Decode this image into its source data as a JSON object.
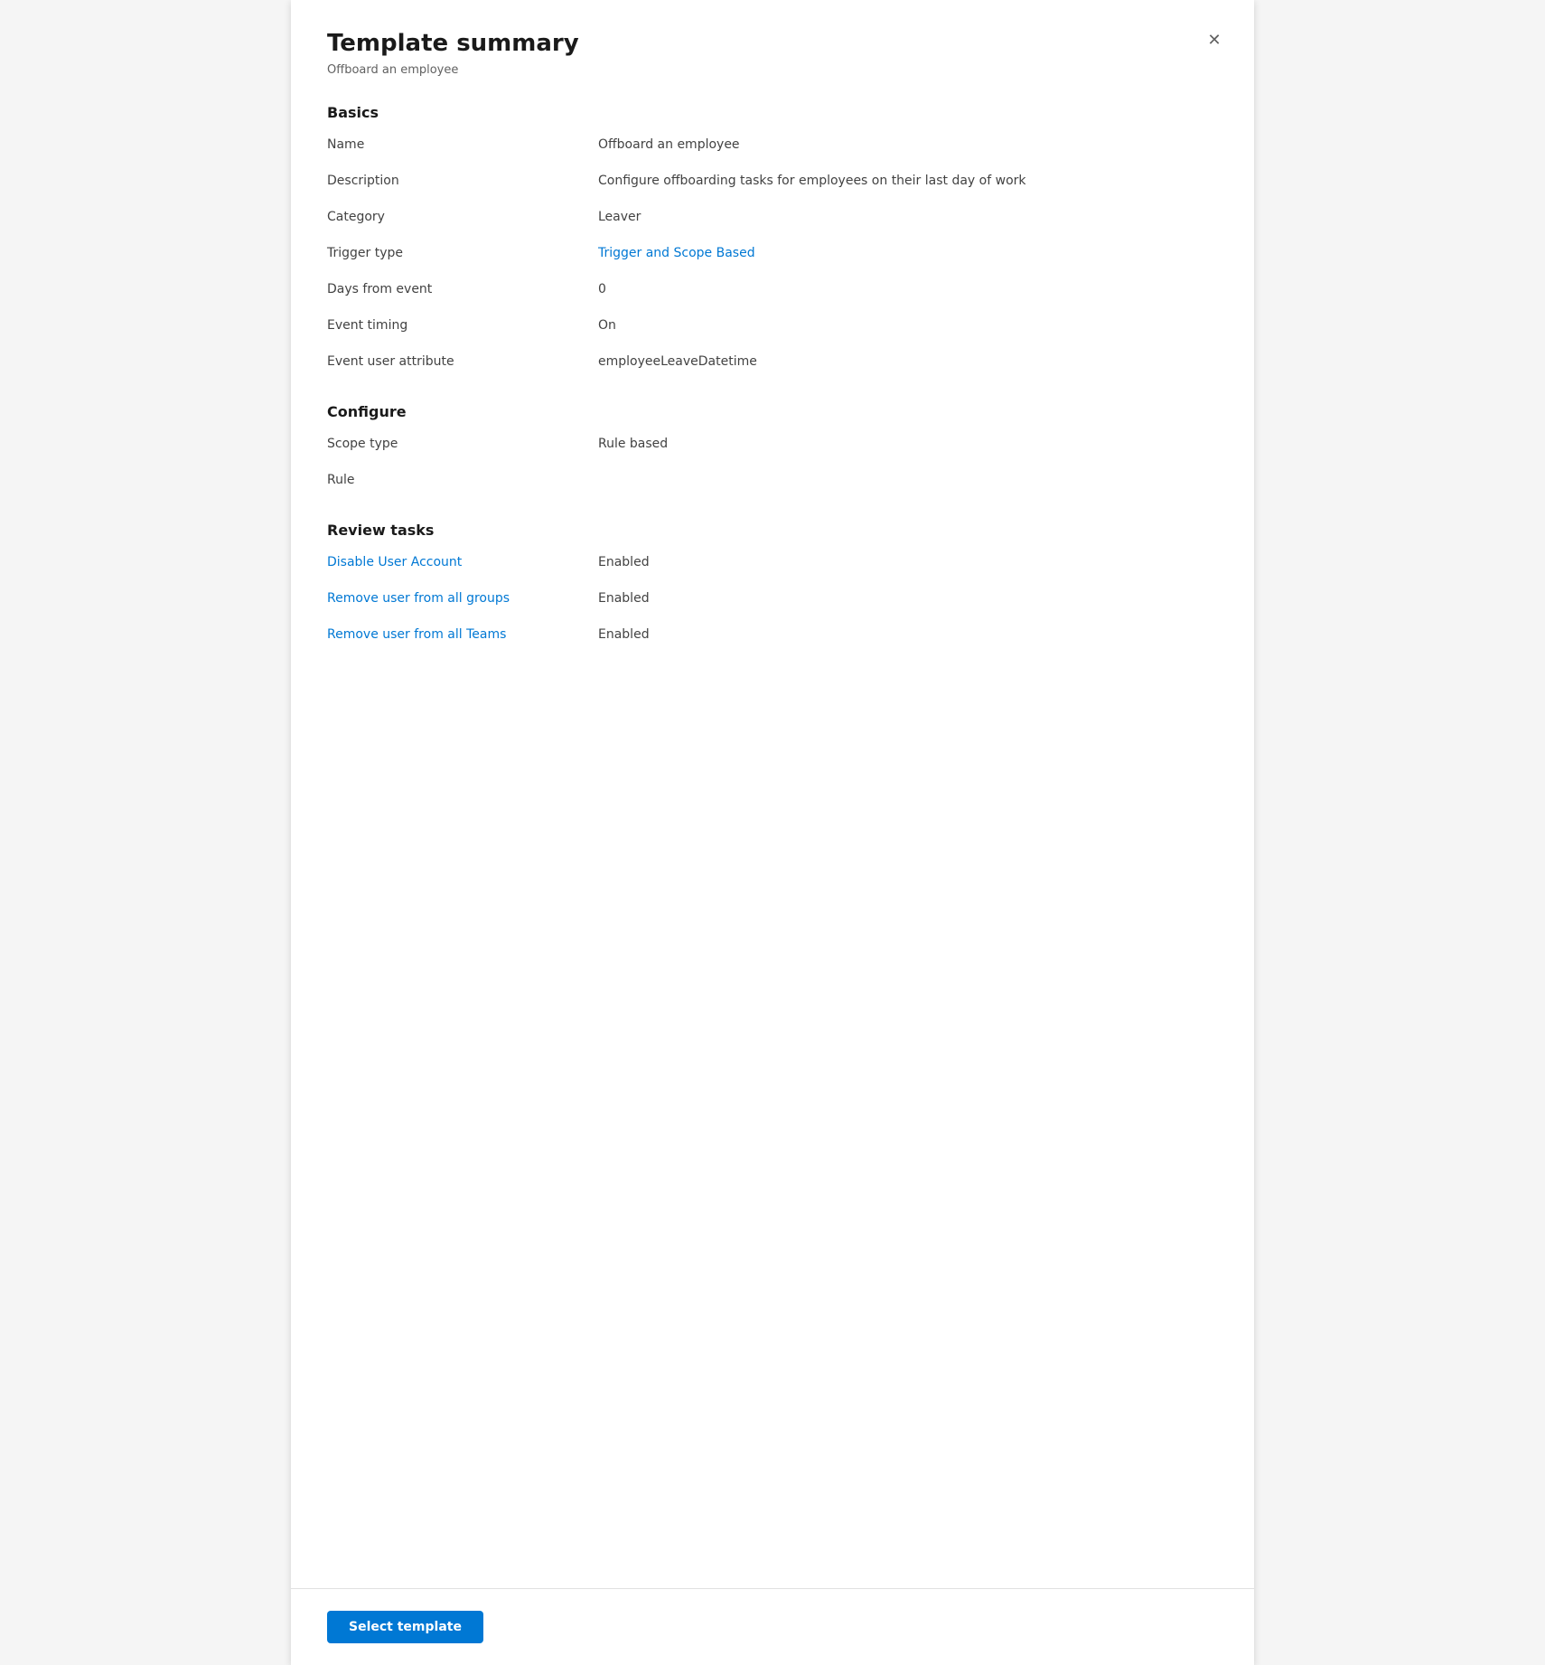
{
  "panel": {
    "title": "Template summary",
    "subtitle": "Offboard an employee",
    "close_label": "✕"
  },
  "sections": {
    "basics": {
      "heading": "Basics",
      "fields": [
        {
          "label": "Name",
          "value": "Offboard an employee",
          "link": false
        },
        {
          "label": "Description",
          "value": "Configure offboarding tasks for employees on their last day of work",
          "link": false
        },
        {
          "label": "Category",
          "value": "Leaver",
          "link": false
        },
        {
          "label": "Trigger type",
          "value": "Trigger and Scope Based",
          "link": true
        },
        {
          "label": "Days from event",
          "value": "0",
          "link": false
        },
        {
          "label": "Event timing",
          "value": "On",
          "link": false
        },
        {
          "label": "Event user attribute",
          "value": "employeeLeaveDatetime",
          "link": false
        }
      ]
    },
    "configure": {
      "heading": "Configure",
      "fields": [
        {
          "label": "Scope type",
          "value": "Rule based",
          "link": false
        },
        {
          "label": "Rule",
          "value": "",
          "link": false
        }
      ]
    },
    "review_tasks": {
      "heading": "Review tasks",
      "fields": [
        {
          "label": "Disable User Account",
          "value": "Enabled",
          "link": true
        },
        {
          "label": "Remove user from all groups",
          "value": "Enabled",
          "link": true
        },
        {
          "label": "Remove user from all Teams",
          "value": "Enabled",
          "link": true
        }
      ]
    }
  },
  "footer": {
    "select_template_label": "Select template"
  }
}
